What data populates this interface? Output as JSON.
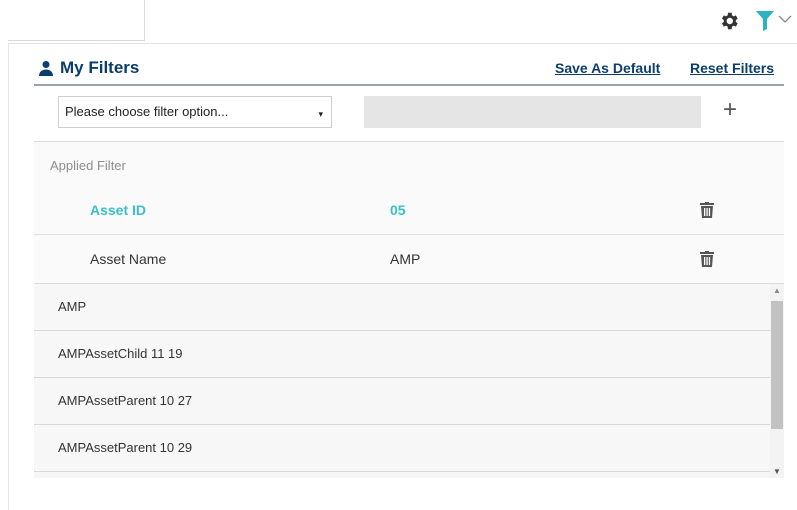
{
  "header": {
    "settings_icon": "gear-icon",
    "filter_icon": "filter-funnel-icon",
    "filter_color": "#2bb3c0"
  },
  "filters": {
    "title": "My Filters",
    "save_default": "Save As Default",
    "reset": "Reset Filters",
    "select_placeholder": "Please choose filter option...",
    "select_caret": "▾",
    "add": "+",
    "applied_label": "Applied Filter",
    "applied": [
      {
        "name": "Asset ID",
        "value": "05",
        "active": true
      },
      {
        "name": "Asset Name",
        "value": "AMP",
        "active": false
      }
    ]
  },
  "list": {
    "items": [
      "AMP",
      "AMPAssetChild 11 19",
      "AMPAssetParent 10 27",
      "AMPAssetParent 10 29"
    ]
  },
  "colors": {
    "accent": "#3bbfc9",
    "title": "#0b3e6d"
  }
}
